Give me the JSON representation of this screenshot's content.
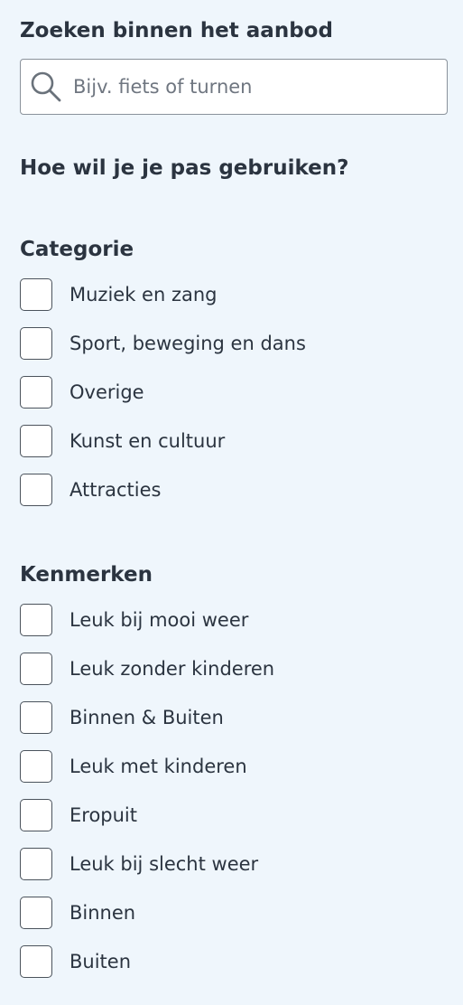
{
  "search": {
    "label": "Zoeken binnen het aanbod",
    "placeholder": "Bijv. fiets of turnen",
    "value": ""
  },
  "usage_heading": "Hoe wil je je pas gebruiken?",
  "categories": {
    "title": "Categorie",
    "items": [
      {
        "label": "Muziek en zang",
        "checked": false
      },
      {
        "label": "Sport, beweging en dans",
        "checked": false
      },
      {
        "label": "Overige",
        "checked": false
      },
      {
        "label": "Kunst en cultuur",
        "checked": false
      },
      {
        "label": "Attracties",
        "checked": false
      }
    ]
  },
  "features": {
    "title": "Kenmerken",
    "items": [
      {
        "label": "Leuk bij mooi weer",
        "checked": false
      },
      {
        "label": "Leuk zonder kinderen",
        "checked": false
      },
      {
        "label": "Binnen & Buiten",
        "checked": false
      },
      {
        "label": "Leuk met kinderen",
        "checked": false
      },
      {
        "label": "Eropuit",
        "checked": false
      },
      {
        "label": "Leuk bij slecht weer",
        "checked": false
      },
      {
        "label": "Binnen",
        "checked": false
      },
      {
        "label": "Buiten",
        "checked": false
      }
    ]
  },
  "icons": {
    "search": "search-icon"
  },
  "colors": {
    "background": "#eff6fc",
    "text": "#2b3440",
    "border": "#4b535c"
  }
}
